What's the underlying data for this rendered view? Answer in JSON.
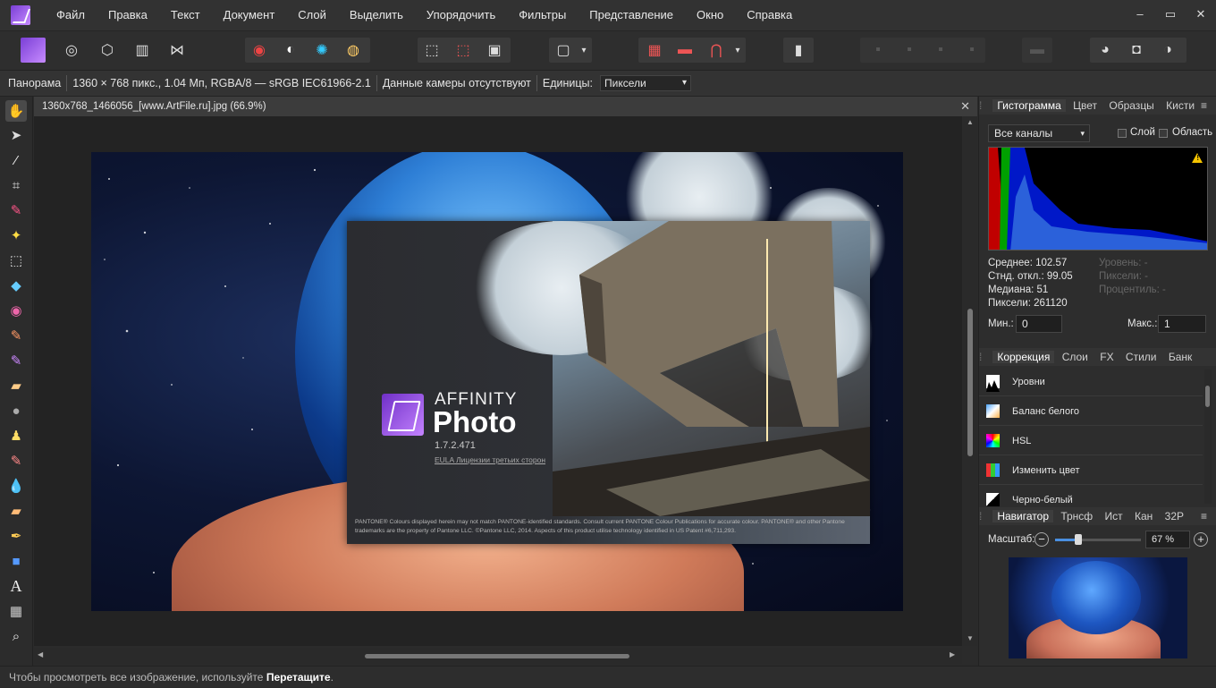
{
  "menu": [
    "Файл",
    "Правка",
    "Текст",
    "Документ",
    "Слой",
    "Выделить",
    "Упорядочить",
    "Фильтры",
    "Представление",
    "Окно",
    "Справка"
  ],
  "window_controls": [
    "–",
    "▭",
    "✕"
  ],
  "context": {
    "mode": "Панорама",
    "info": "1360 × 768 пикс., 1.04 Мп, RGBA/8 — sRGB IEC61966-2.1",
    "camera": "Данные камеры отсутствуют",
    "units_label": "Единицы:",
    "units_value": "Пиксели"
  },
  "document": {
    "title": "1360x768_1466056_[www.ArtFile.ru].jpg (66.9%)",
    "close": "✕"
  },
  "splash": {
    "brand": "AFFINITY",
    "product": "Photo",
    "version": "1.7.2.471",
    "links": "EULA   Лицензии третьих сторон",
    "legal": "PANTONE® Colours displayed herein may not match PANTONE-identified standards. Consult current PANTONE Colour Publications for accurate colour. PANTONE® and other Pantone trademarks are the property of Pantone LLC. ©Pantone LLC, 2014. Aspects of this product utilise technology identified in US Patent #6,711,293."
  },
  "histogram_panel": {
    "tabs": [
      "Гистограмма",
      "Цвет",
      "Образцы",
      "Кисти"
    ],
    "channels": "Все каналы",
    "layer_label": "Слой",
    "area_label": "Область",
    "stats_left": [
      "Среднее: 102.57",
      "Стнд. откл.: 99.05",
      "Медиана: 51",
      "Пиксели: 261120"
    ],
    "stats_right": [
      "Уровень: -",
      "Пиксели: -",
      "Процентиль: -"
    ],
    "min_label": "Мин.:",
    "min_value": "0",
    "max_label": "Макс.:",
    "max_value": "1",
    "warning": "!"
  },
  "adjust_panel": {
    "tabs": [
      "Коррекция",
      "Слои",
      "FX",
      "Стили",
      "Банк"
    ],
    "items": [
      "Уровни",
      "Баланс белого",
      "HSL",
      "Изменить цвет",
      "Черно-белый"
    ]
  },
  "navigator_panel": {
    "tabs": [
      "Навигатор",
      "Трнсф",
      "Ист",
      "Кан",
      "32Р"
    ],
    "zoom_label": "Масштаб:",
    "zoom_value": "67 %",
    "zoom_fraction": 0.67
  },
  "status": {
    "text": "Чтобы просмотреть все изображение, используйте",
    "bold": "Перетащите",
    "end": "."
  },
  "colors": {
    "accent": "#9b55e8",
    "menubar": "#323232",
    "panel": "#2d2d2d"
  }
}
